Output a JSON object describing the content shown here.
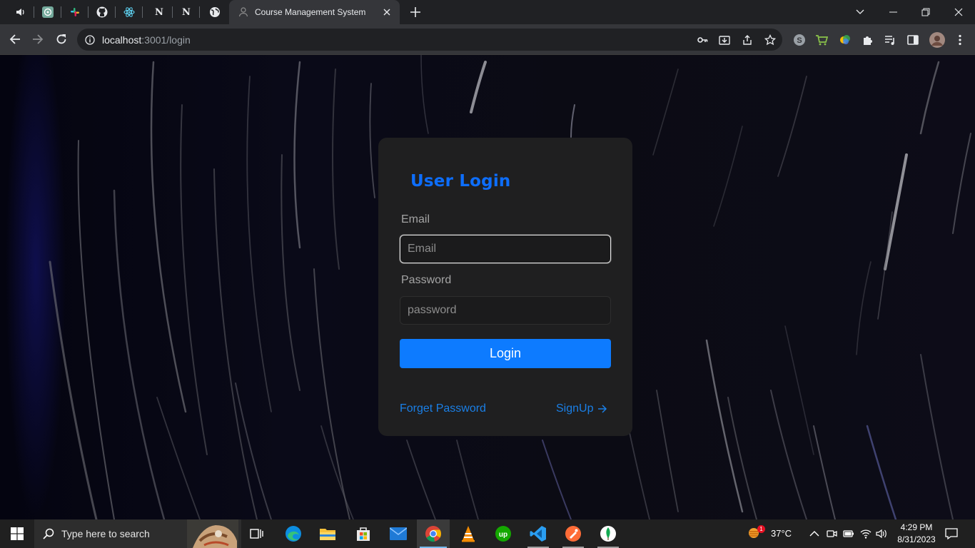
{
  "browser": {
    "active_tab_title": "Course Management System",
    "pinned_tabs": [
      "speaker-icon",
      "chatgpt-icon",
      "slack-icon",
      "github-icon",
      "react-icon",
      "notion-icon",
      "notion-icon",
      "globe-icon"
    ],
    "url_host": "localhost",
    "url_rest": ":3001/login"
  },
  "login": {
    "title": "User Login",
    "email_label": "Email",
    "email_placeholder": "Email",
    "password_label": "Password",
    "password_placeholder": "password",
    "login_button": "Login",
    "forget_password": "Forget Password",
    "signup": "SignUp"
  },
  "colors": {
    "accent": "#0d7bff",
    "title": "#0d6efd",
    "card": "#1f1f20"
  },
  "taskbar": {
    "search_placeholder": "Type here to search",
    "weather": "37°C",
    "weather_badge": "1",
    "time": "4:29 PM",
    "date": "8/31/2023"
  }
}
